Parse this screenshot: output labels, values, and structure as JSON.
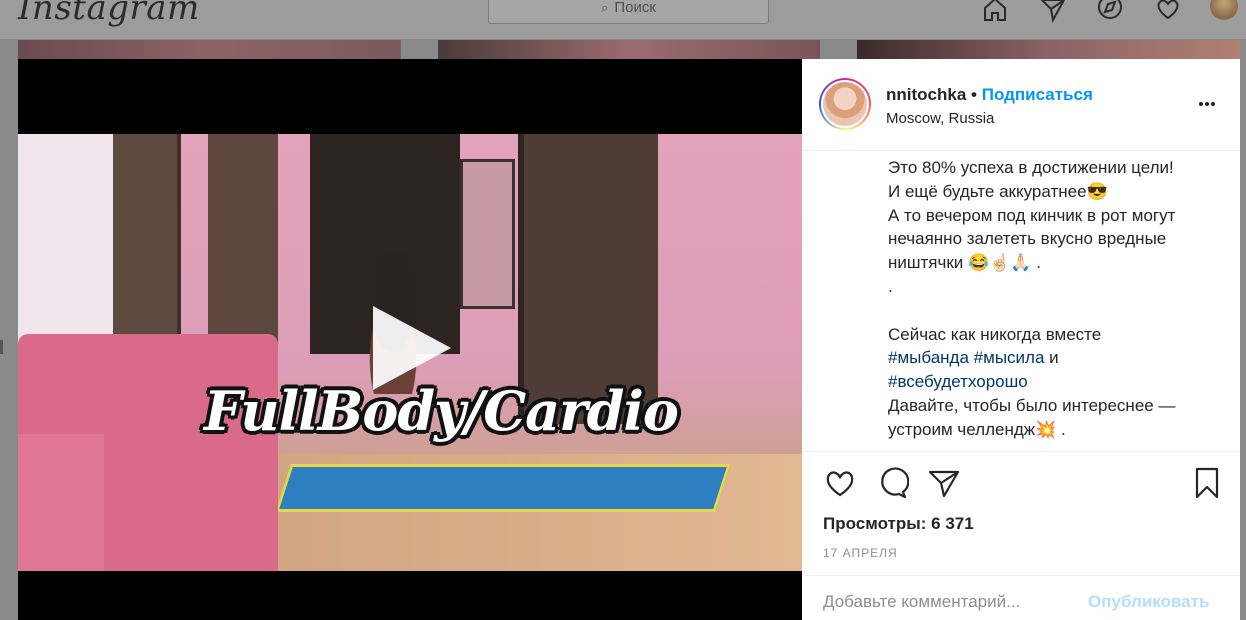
{
  "app": {
    "logo": "Instagram"
  },
  "header": {
    "search_placeholder": "Поиск",
    "nav_icons": [
      "home-icon",
      "direct-icon",
      "explore-icon",
      "activity-heart-icon",
      "profile-avatar"
    ]
  },
  "post": {
    "username": "nnitochka",
    "separator": "•",
    "follow_label": "Подписаться",
    "location": "Moscow, Russia",
    "video_overlay_text": "FullBody/Cardio",
    "caption_lines": [
      {
        "text": "Это 80% успеха в достижении цели!",
        "type": "text"
      },
      {
        "text": "И ещё будьте аккуратнее😎",
        "type": "text"
      },
      {
        "text": "А то вечером под кинчик в рот могут",
        "type": "text"
      },
      {
        "text": "нечаянно залететь вкусно вредные",
        "type": "text"
      },
      {
        "text": "ништячки 😂☝🏻🙏🏻 .",
        "type": "text"
      },
      {
        "text": ".",
        "type": "text"
      },
      {
        "text": "",
        "type": "blank"
      },
      {
        "text": "Сейчас как никогда вместе",
        "type": "text"
      }
    ],
    "hashtag_line_1": {
      "tag1": "#мыбанда",
      "tag2": "#мысила",
      "suffix": "и"
    },
    "hashtag_line_2": "#всебудетхорошо",
    "caption_tail": [
      "Давайте, чтобы было интереснее —",
      "устроим челлендж💥 ."
    ],
    "views_label": "Просмотры: 6 371",
    "date": "17 АПРЕЛЯ",
    "comment_placeholder": "Добавьте комментарий...",
    "publish_label": "Опубликовать"
  },
  "colors": {
    "accent_blue": "#0095f6",
    "hashtag": "#00376b",
    "publish_disabled": "#b2dffc",
    "overlay_dim": "#8a8a8a"
  }
}
